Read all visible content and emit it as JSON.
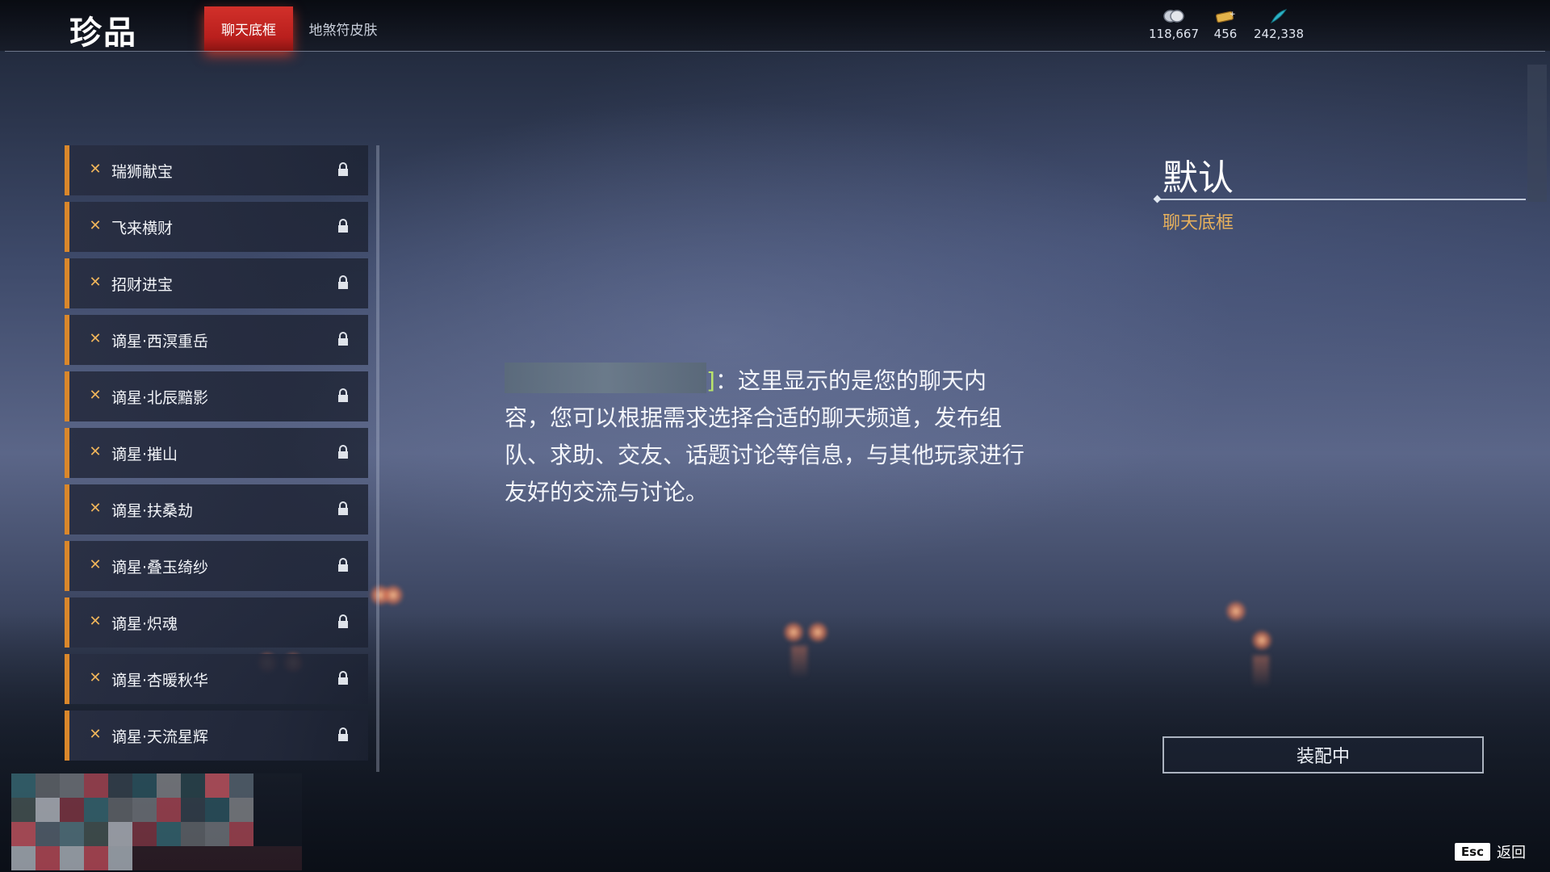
{
  "header": {
    "title": "珍品",
    "tabs": [
      {
        "label": "聊天底框",
        "active": true
      },
      {
        "label": "地煞符皮肤",
        "active": false
      }
    ],
    "currencies": [
      {
        "icon": "coin-icon",
        "value": "118,667"
      },
      {
        "icon": "ticket-icon",
        "value": "456"
      },
      {
        "icon": "feather-icon",
        "value": "242,338"
      }
    ]
  },
  "items": [
    {
      "label": "瑞狮献宝",
      "locked": true
    },
    {
      "label": "飞来横财",
      "locked": true
    },
    {
      "label": "招财进宝",
      "locked": true
    },
    {
      "label": "谪星·西溟重岳",
      "locked": true
    },
    {
      "label": "谪星·北辰黯影",
      "locked": true
    },
    {
      "label": "谪星·摧山",
      "locked": true
    },
    {
      "label": "谪星·扶桑劫",
      "locked": true
    },
    {
      "label": "谪星·叠玉绮纱",
      "locked": true
    },
    {
      "label": "谪星·炽魂",
      "locked": true
    },
    {
      "label": "谪星·杏暖秋华",
      "locked": true
    },
    {
      "label": "谪星·天流星辉",
      "locked": true
    }
  ],
  "preview": {
    "bracket": "]",
    "text": "：这里显示的是您的聊天内容，您可以根据需求选择合适的聊天频道，发布组队、求助、交友、话题讨论等信息，与其他玩家进行友好的交流与讨论。"
  },
  "detail": {
    "title": "默认",
    "type": "聊天底框",
    "equip_label": "装配中"
  },
  "footer": {
    "esc_key": "Esc",
    "back_label": "返回"
  },
  "colors": {
    "accent_orange": "#d9872b",
    "tab_active_red": "#c92824",
    "type_gold": "#e8b15c"
  }
}
